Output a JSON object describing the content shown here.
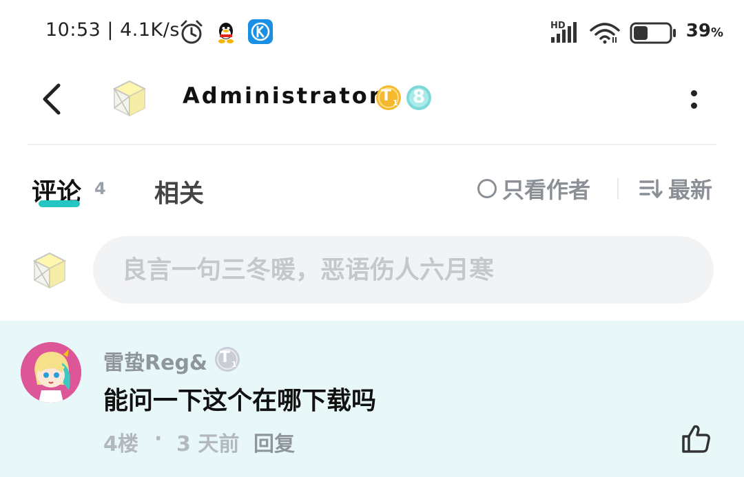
{
  "status_bar": {
    "time": "10:53 | 4.1K/s",
    "network_label": "HD",
    "battery_percent": "39",
    "battery_unit": "%",
    "battery_level": 0.39,
    "icons": [
      "alarm-icon",
      "qq-icon",
      "kugou-icon",
      "signal-icon",
      "wifi-icon",
      "battery-icon"
    ]
  },
  "header": {
    "username": "Administrator",
    "badge_t_letter": "T",
    "badge_t_sub": "1",
    "level": "8",
    "colors": {
      "badge_gold": "#f5b82e",
      "badge_level": "#7fd8d8"
    }
  },
  "tabs": {
    "comments_label": "评论",
    "comments_count": "4",
    "related_label": "相关",
    "author_only_label": "只看作者",
    "sort_label": "最新",
    "accent_color": "#26c6c0"
  },
  "comment_input": {
    "placeholder": "良言一句三冬暖，恶语伤人六月寒"
  },
  "comment": {
    "username": "雷蛰Reg&",
    "badge_letter": "T",
    "badge_sub": "1",
    "text": "能问一下这个在哪下载吗",
    "floor": "4楼",
    "separator": "·",
    "time": "3 天前",
    "reply_label": "回复",
    "background_color": "#e8f8f8"
  }
}
